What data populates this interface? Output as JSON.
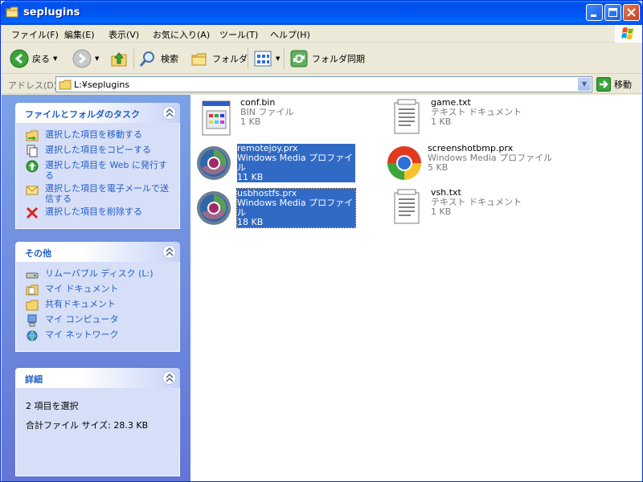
{
  "window": {
    "title": "seplugins"
  },
  "menu": {
    "items": [
      "ファイル(F)",
      "編集(E)",
      "表示(V)",
      "お気に入り(A)",
      "ツール(T)",
      "ヘルプ(H)"
    ]
  },
  "toolbar": {
    "back_label": "戻る",
    "search_label": "検索",
    "folders_label": "フォルダ",
    "sync_label": "フォルダ同期"
  },
  "address": {
    "label": "アドレス(D)",
    "value": "L:¥seplugins",
    "go_label": "移動"
  },
  "tasks_panel": {
    "title": "ファイルとフォルダのタスク",
    "items": [
      {
        "label": "選択した項目を移動する",
        "icon": "move-icon"
      },
      {
        "label": "選択した項目をコピーする",
        "icon": "copy-icon"
      },
      {
        "label": "選択した項目を Web に発行する",
        "icon": "publish-web-icon"
      },
      {
        "label": "選択した項目を電子メールで送信する",
        "icon": "email-icon"
      },
      {
        "label": "選択した項目を削除する",
        "icon": "delete-icon"
      }
    ]
  },
  "other_panel": {
    "title": "その他",
    "items": [
      {
        "label": "リムーバブル ディスク (L:)",
        "icon": "removable-disk-icon"
      },
      {
        "label": "マイ ドキュメント",
        "icon": "my-documents-icon"
      },
      {
        "label": "共有ドキュメント",
        "icon": "shared-documents-icon"
      },
      {
        "label": "マイ コンピュータ",
        "icon": "my-computer-icon"
      },
      {
        "label": "マイ ネットワーク",
        "icon": "my-network-icon"
      }
    ]
  },
  "details_panel": {
    "title": "詳細",
    "selection_text": "2 項目を選択",
    "size_text": "合計ファイル サイズ: 28.3 KB"
  },
  "files": [
    {
      "name": "conf.bin",
      "type": "BIN ファイル",
      "size": "1 KB",
      "icon": "bin-file-icon",
      "selected": false
    },
    {
      "name": "game.txt",
      "type": "テキスト ドキュメント",
      "size": "1 KB",
      "icon": "text-file-icon",
      "selected": false
    },
    {
      "name": "remotejoy.prx",
      "type": "Windows Media プロファイル",
      "size": "11 KB",
      "icon": "media-profile-icon",
      "selected": true
    },
    {
      "name": "screenshotbmp.prx",
      "type": "Windows Media プロファイル",
      "size": "5 KB",
      "icon": "media-profile-icon",
      "selected": false
    },
    {
      "name": "usbhostfs.prx",
      "type": "Windows Media プロファイル",
      "size": "18 KB",
      "icon": "media-profile-icon",
      "selected": true
    },
    {
      "name": "vsh.txt",
      "type": "テキスト ドキュメント",
      "size": "1 KB",
      "icon": "text-file-icon",
      "selected": false
    }
  ],
  "colors": {
    "titlebar": "#0054e3",
    "selection": "#316ac5",
    "task_link": "#215dc6",
    "taskpane": "#7ba2e7"
  }
}
